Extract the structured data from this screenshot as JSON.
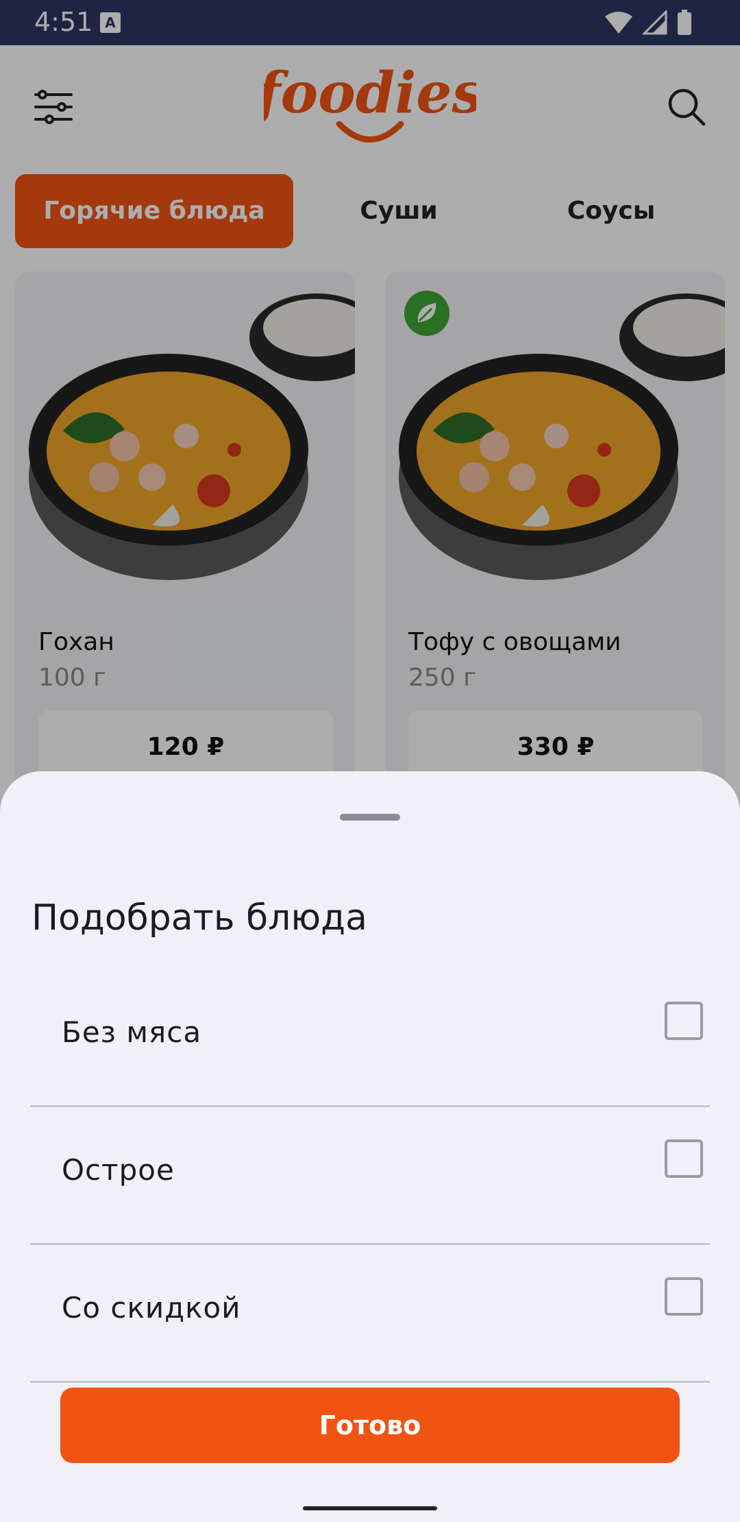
{
  "status_bar": {
    "time": "4:51",
    "notification_letter": "A",
    "icons": [
      "wifi-icon",
      "cell-signal-icon",
      "battery-icon"
    ]
  },
  "header": {
    "logo_text": "foodies",
    "icons": [
      "filter-icon",
      "search-icon"
    ]
  },
  "tabs": [
    {
      "label": "Горячие блюда",
      "active": true
    },
    {
      "label": "Суши",
      "active": false
    },
    {
      "label": "Соусы",
      "active": false
    }
  ],
  "products": [
    {
      "name": "Гохан",
      "weight": "100 г",
      "price": "120 ₽",
      "vegetarian": false
    },
    {
      "name": "Тофу с овощами",
      "weight": "250 г",
      "price": "330 ₽",
      "vegetarian": true
    }
  ],
  "sheet": {
    "title": "Подобрать блюда",
    "options": [
      {
        "label": "Без мяса",
        "checked": false
      },
      {
        "label": "Острое",
        "checked": false
      },
      {
        "label": "Со скидкой",
        "checked": false
      }
    ],
    "done_label": "Готово"
  },
  "colors": {
    "accent": "#f15412",
    "statusbar": "#2e3563",
    "sheet_bg": "#f1f0f6",
    "veg": "#3fa535"
  }
}
